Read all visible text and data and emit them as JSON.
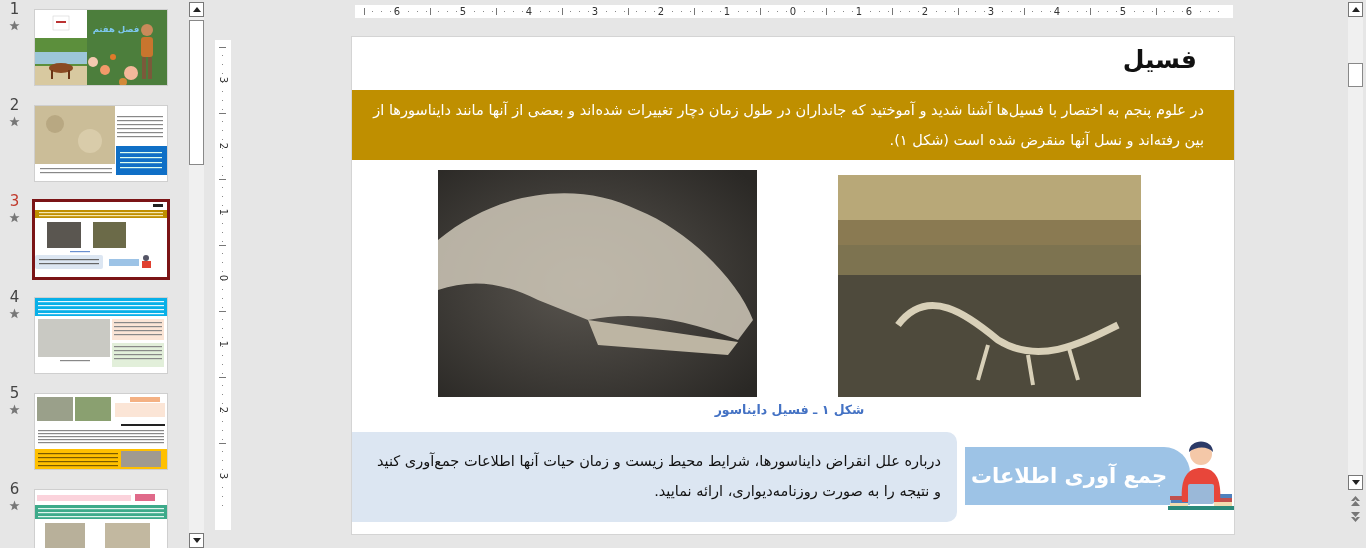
{
  "thumbnail_panel": {
    "slides": [
      {
        "number": "1",
        "selected": false,
        "kind": "cover",
        "title": "فصل هفتم"
      },
      {
        "number": "2",
        "selected": false,
        "kind": "photo-text"
      },
      {
        "number": "3",
        "selected": true,
        "kind": "fossil"
      },
      {
        "number": "4",
        "selected": false,
        "kind": "banner"
      },
      {
        "number": "5",
        "selected": false,
        "kind": "collage"
      },
      {
        "number": "6",
        "selected": false,
        "kind": "pink"
      }
    ]
  },
  "horizontal_ruler": {
    "labels": [
      "6",
      "5",
      "4",
      "3",
      "2",
      "1",
      "0",
      "1",
      "2",
      "3",
      "4",
      "5",
      "6"
    ]
  },
  "vertical_ruler": {
    "labels": [
      "3",
      "2",
      "1",
      "0",
      "1",
      "2",
      "3"
    ]
  },
  "slide": {
    "title": "فسیل",
    "intro": "در علوم پنجم به اختصار با فسیل‌ها آشنا شدید و آموختید که جانداران در طول زمان دچار تغییرات شده‌اند و بعضی از آنها مانند دایناسورها از بین رفته‌اند و نسل آنها منقرض شده است (شکل ۱).",
    "figures": [
      {
        "kind": "skull"
      },
      {
        "kind": "excavation"
      }
    ],
    "caption": "شکل ۱ ـ فسیل دایناسور",
    "activity": {
      "label": "جمع آوری اطلاعات",
      "text": "درباره علل انقراض دایناسورها، شرایط محیط زیست و زمان حیات آنها اطلاعات جمع‌آوری کنید و نتیجه را به صورت روزنامه‌دیواری، ارائه نمایید."
    }
  }
}
